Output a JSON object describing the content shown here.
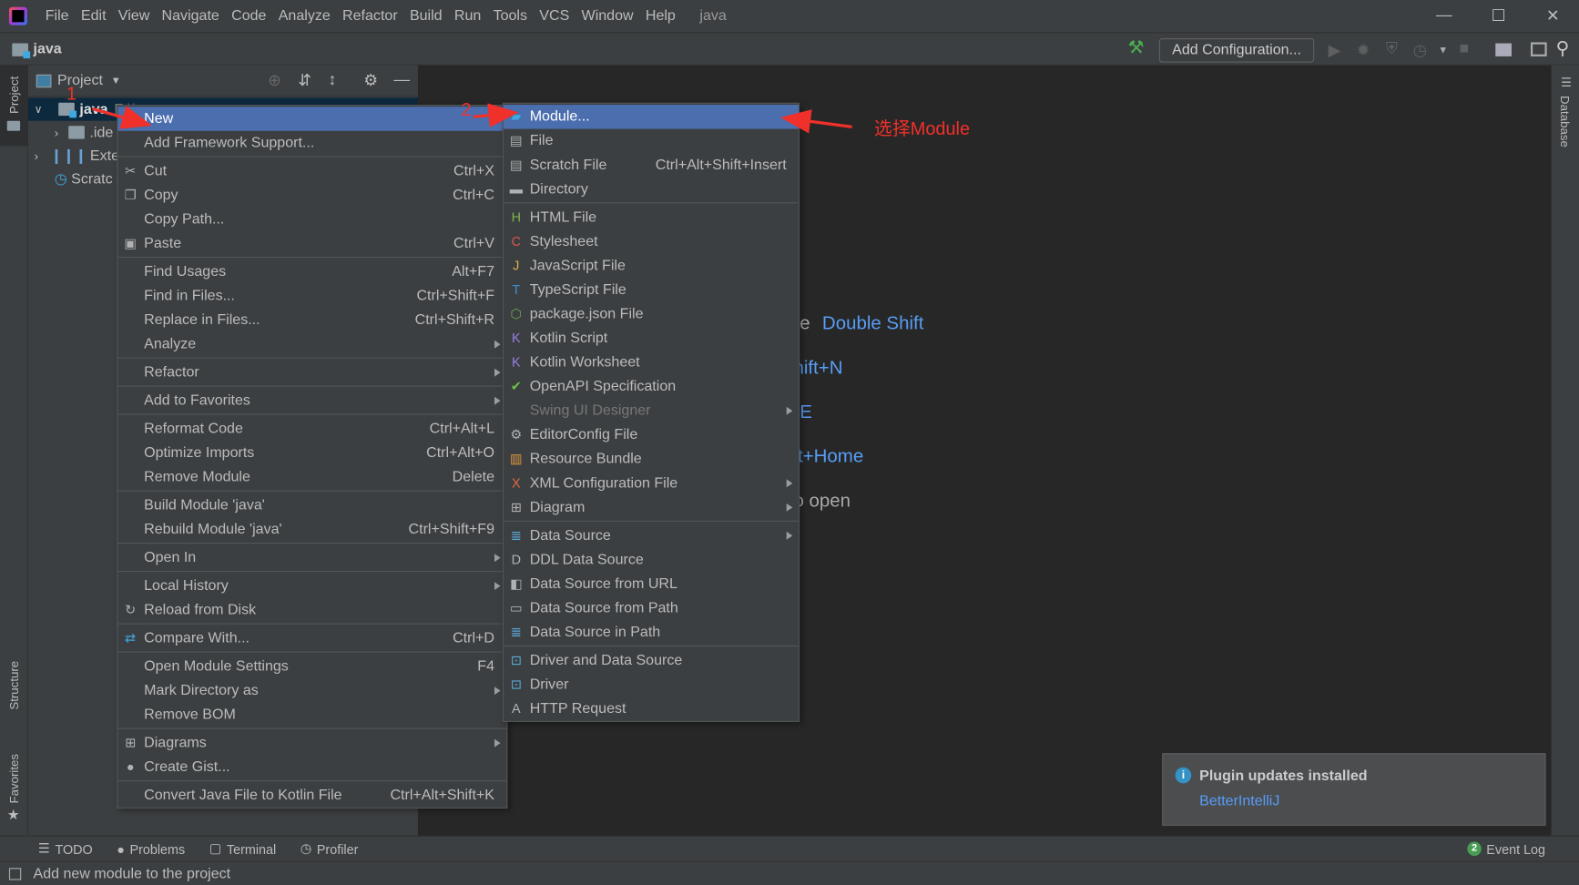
{
  "menubar": {
    "items": [
      "File",
      "Edit",
      "View",
      "Navigate",
      "Code",
      "Analyze",
      "Refactor",
      "Build",
      "Run",
      "Tools",
      "VCS",
      "Window",
      "Help"
    ],
    "window_title": "java"
  },
  "navbar": {
    "crumb": "java",
    "add_configuration": "Add Configuration..."
  },
  "left_stripe": {
    "project": "Project",
    "structure": "Structure",
    "favorites": "Favorites"
  },
  "right_stripe": {
    "database": "Database"
  },
  "project_panel": {
    "title": "Project",
    "tree": [
      {
        "label": "java",
        "suffix": "E:\\i"
      },
      {
        "label": ".ide"
      },
      {
        "label": "Extern"
      },
      {
        "label": "Scratc"
      }
    ]
  },
  "editor_hints": [
    {
      "gray": "re",
      "blue": "Double Shift"
    },
    {
      "gray": "",
      "blue": "hift+N"
    },
    {
      "gray": "",
      "blue": "-E"
    },
    {
      "gray": "",
      "blue": "lt+Home"
    },
    {
      "gray": "o open",
      "blue": ""
    }
  ],
  "context_menu": [
    {
      "label": "New",
      "arrow": true,
      "selected": true
    },
    {
      "label": "Add Framework Support..."
    },
    {
      "sep": true
    },
    {
      "label": "Cut",
      "shortcut": "Ctrl+X",
      "icon": "scissors-icon"
    },
    {
      "label": "Copy",
      "shortcut": "Ctrl+C",
      "icon": "copy-icon"
    },
    {
      "label": "Copy Path..."
    },
    {
      "label": "Paste",
      "shortcut": "Ctrl+V",
      "icon": "paste-icon"
    },
    {
      "sep": true
    },
    {
      "label": "Find Usages",
      "shortcut": "Alt+F7"
    },
    {
      "label": "Find in Files...",
      "shortcut": "Ctrl+Shift+F"
    },
    {
      "label": "Replace in Files...",
      "shortcut": "Ctrl+Shift+R"
    },
    {
      "label": "Analyze",
      "arrow": true
    },
    {
      "sep": true
    },
    {
      "label": "Refactor",
      "arrow": true
    },
    {
      "sep": true
    },
    {
      "label": "Add to Favorites",
      "arrow": true
    },
    {
      "sep": true
    },
    {
      "label": "Reformat Code",
      "shortcut": "Ctrl+Alt+L"
    },
    {
      "label": "Optimize Imports",
      "shortcut": "Ctrl+Alt+O"
    },
    {
      "label": "Remove Module",
      "shortcut": "Delete"
    },
    {
      "sep": true
    },
    {
      "label": "Build Module 'java'"
    },
    {
      "label": "Rebuild Module 'java'",
      "shortcut": "Ctrl+Shift+F9"
    },
    {
      "sep": true
    },
    {
      "label": "Open In",
      "arrow": true
    },
    {
      "sep": true
    },
    {
      "label": "Local History",
      "arrow": true
    },
    {
      "label": "Reload from Disk",
      "icon": "reload-icon"
    },
    {
      "sep": true
    },
    {
      "label": "Compare With...",
      "shortcut": "Ctrl+D",
      "icon": "compare-icon"
    },
    {
      "sep": true
    },
    {
      "label": "Open Module Settings",
      "shortcut": "F4"
    },
    {
      "label": "Mark Directory as",
      "arrow": true
    },
    {
      "label": "Remove BOM"
    },
    {
      "sep": true
    },
    {
      "label": "Diagrams",
      "arrow": true,
      "icon": "diagram-icon"
    },
    {
      "label": "Create Gist...",
      "icon": "github-icon"
    },
    {
      "sep": true
    },
    {
      "label": "Convert Java File to Kotlin File",
      "shortcut": "Ctrl+Alt+Shift+K"
    }
  ],
  "new_submenu": [
    {
      "label": "Module...",
      "selected": true,
      "icon": "module-icon"
    },
    {
      "label": "File",
      "icon": "file-icon"
    },
    {
      "label": "Scratch File",
      "shortcut": "Ctrl+Alt+Shift+Insert",
      "icon": "scratch-file-icon"
    },
    {
      "label": "Directory",
      "icon": "folder-icon"
    },
    {
      "sep": true
    },
    {
      "label": "HTML File",
      "icon": "html-icon"
    },
    {
      "label": "Stylesheet",
      "icon": "css-icon"
    },
    {
      "label": "JavaScript File",
      "icon": "js-icon"
    },
    {
      "label": "TypeScript File",
      "icon": "ts-icon"
    },
    {
      "label": "package.json File",
      "icon": "nodejs-icon"
    },
    {
      "label": "Kotlin Script",
      "icon": "kotlin-icon"
    },
    {
      "label": "Kotlin Worksheet",
      "icon": "kotlin-icon"
    },
    {
      "label": "OpenAPI Specification",
      "icon": "openapi-icon"
    },
    {
      "label": "Swing UI Designer",
      "arrow": true,
      "disabled": true
    },
    {
      "label": "EditorConfig File",
      "icon": "gear-icon"
    },
    {
      "label": "Resource Bundle",
      "icon": "resource-bundle-icon"
    },
    {
      "label": "XML Configuration File",
      "arrow": true,
      "icon": "xml-icon"
    },
    {
      "label": "Diagram",
      "arrow": true,
      "icon": "diagram-icon"
    },
    {
      "sep": true
    },
    {
      "label": "Data Source",
      "arrow": true,
      "icon": "database-icon"
    },
    {
      "label": "DDL Data Source",
      "icon": "ddl-icon"
    },
    {
      "label": "Data Source from URL",
      "icon": "url-icon"
    },
    {
      "label": "Data Source from Path",
      "icon": "folder-open-icon"
    },
    {
      "label": "Data Source in Path",
      "icon": "database-icon"
    },
    {
      "sep": true
    },
    {
      "label": "Driver and Data Source",
      "icon": "driver-icon"
    },
    {
      "label": "Driver",
      "icon": "driver-icon"
    },
    {
      "label": "HTTP Request",
      "icon": "api-icon"
    }
  ],
  "annotations": {
    "step1": "1",
    "step2": "2",
    "note": "选择Module",
    "color": "#f0302a"
  },
  "notification": {
    "title": "Plugin updates installed",
    "link": "BetterIntelliJ"
  },
  "tool_windows": [
    "TODO",
    "Problems",
    "Terminal",
    "Profiler"
  ],
  "event_log": {
    "count": "2",
    "label": "Event Log"
  },
  "status": {
    "text": "Add new module to the project"
  },
  "colors": {
    "selection": "#4b6eaf",
    "link": "#589df6",
    "panel": "#3c3f41",
    "editor": "#272727"
  }
}
